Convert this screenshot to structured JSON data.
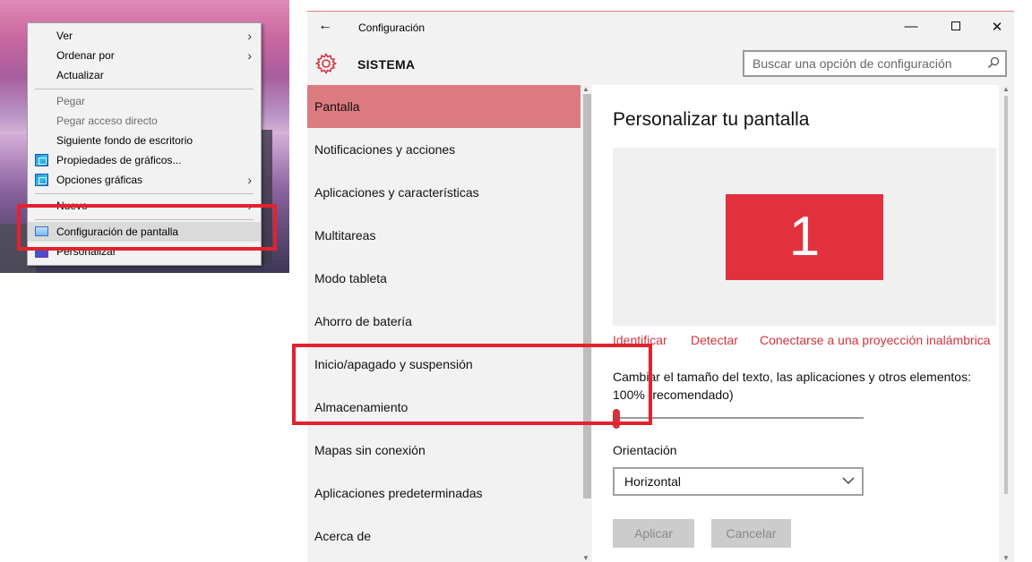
{
  "context_menu": {
    "items": [
      {
        "label": "Ver",
        "has_submenu": true
      },
      {
        "label": "Ordenar por",
        "has_submenu": true
      },
      {
        "label": "Actualizar"
      },
      {
        "label": "Pegar",
        "disabled": true
      },
      {
        "label": "Pegar acceso directo",
        "disabled": true
      },
      {
        "label": "Siguiente fondo de escritorio"
      },
      {
        "label": "Propiedades de gráficos...",
        "icon": "graphics-icon"
      },
      {
        "label": "Opciones gráficas",
        "icon": "graphics-icon",
        "has_submenu": true
      },
      {
        "label": "Nuevo",
        "has_submenu": true
      },
      {
        "label": "Configuración de pantalla",
        "icon": "display-icon",
        "highlighted": true
      },
      {
        "label": "Personalizar",
        "icon": "personalize-icon"
      }
    ],
    "submenu_arrow": "›"
  },
  "window": {
    "back_glyph": "←",
    "title": "Configuración",
    "minimize_glyph": "—",
    "close_glyph": "✕"
  },
  "header": {
    "section_title": "SISTEMA",
    "search_placeholder": "Buscar una opción de configuración"
  },
  "nav": {
    "items": [
      {
        "label": "Pantalla",
        "active": true
      },
      {
        "label": "Notificaciones y acciones"
      },
      {
        "label": "Aplicaciones y características"
      },
      {
        "label": "Multitareas"
      },
      {
        "label": "Modo tableta"
      },
      {
        "label": "Ahorro de batería"
      },
      {
        "label": "Inicio/apagado y suspensión"
      },
      {
        "label": "Almacenamiento"
      },
      {
        "label": "Mapas sin conexión"
      },
      {
        "label": "Aplicaciones predeterminadas"
      },
      {
        "label": "Acerca de"
      }
    ]
  },
  "content": {
    "page_title": "Personalizar tu pantalla",
    "monitor_number": "1",
    "links": {
      "identify": "Identificar",
      "detect": "Detectar",
      "connect": "Conectarse a una proyección inalámbrica"
    },
    "scale_label": "Cambiar el tamaño del texto, las aplicaciones y otros elementos: 100% (recomendado)",
    "scale_value_percent": 100,
    "orientation_label": "Orientación",
    "orientation_value": "Horizontal",
    "apply_label": "Aplicar",
    "cancel_label": "Cancelar"
  },
  "colors": {
    "accent": "#e2313c",
    "highlight_box": "#e3222e",
    "nav_active": "#db7b80"
  }
}
